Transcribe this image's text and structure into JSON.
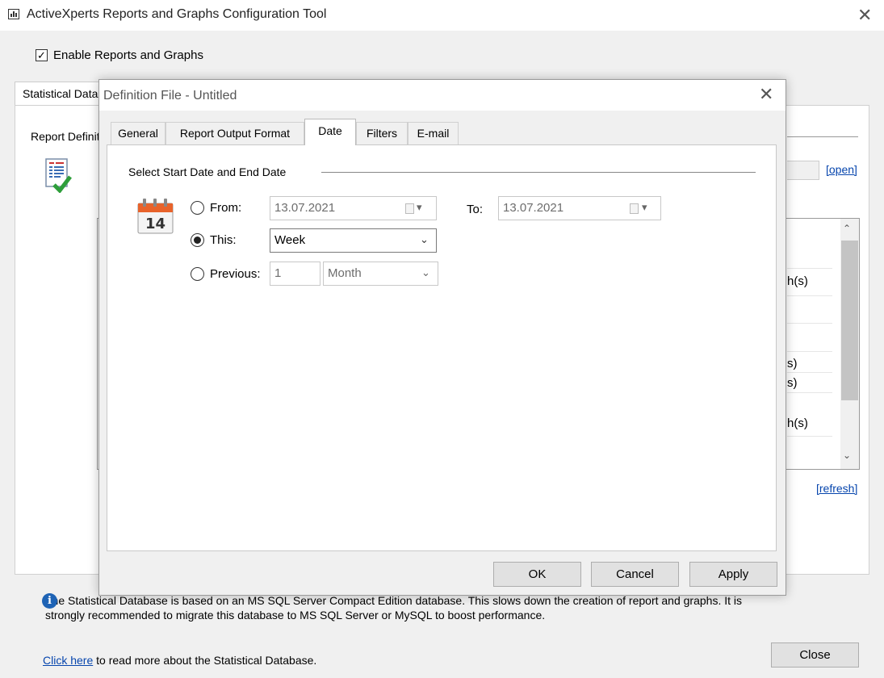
{
  "window": {
    "title": "ActiveXperts Reports and Graphs Configuration Tool",
    "close_glyph": "✕"
  },
  "main": {
    "enable_checkbox_label": "Enable Reports and Graphs",
    "enable_checked": true,
    "tab_label": "Statistical Database",
    "report_definition_label": "Report Definition",
    "open_link": "[open]",
    "refresh_link": "[refresh]",
    "list_row_fragments": [
      "h(s)",
      "s)",
      "s)",
      "h(s)"
    ],
    "info_line1": "The Statistical Database is based on an MS SQL Server Compact Edition database. This slows down the creation of report and graphs. It is",
    "info_line2": "strongly recommended to migrate this database to MS SQL Server or MySQL to boost performance.",
    "click_here_link": "Click here",
    "click_here_rest": " to read more about the Statistical Database.",
    "close_button": "Close"
  },
  "dialog": {
    "title": "Definition File - Untitled",
    "close_glyph": "✕",
    "tabs": [
      {
        "label": "General"
      },
      {
        "label": "Report Output Format"
      },
      {
        "label": "Date"
      },
      {
        "label": "Filters"
      },
      {
        "label": "E-mail"
      }
    ],
    "active_tab": "Date",
    "group_label": "Select Start Date and End Date",
    "calendar_day": "14",
    "from_label": "From:",
    "from_value": "13.07.2021",
    "to_label": "To:",
    "to_value": "13.07.2021",
    "this_label": "This:",
    "this_value": "Week",
    "previous_label": "Previous:",
    "previous_count": "1",
    "previous_unit": "Month",
    "selected_option": "This",
    "ok_button": "OK",
    "cancel_button": "Cancel",
    "apply_button": "Apply"
  },
  "colors": {
    "link": "#0645ad",
    "info_icon": "#1e63b5",
    "calendar_header": "#e8632b"
  }
}
